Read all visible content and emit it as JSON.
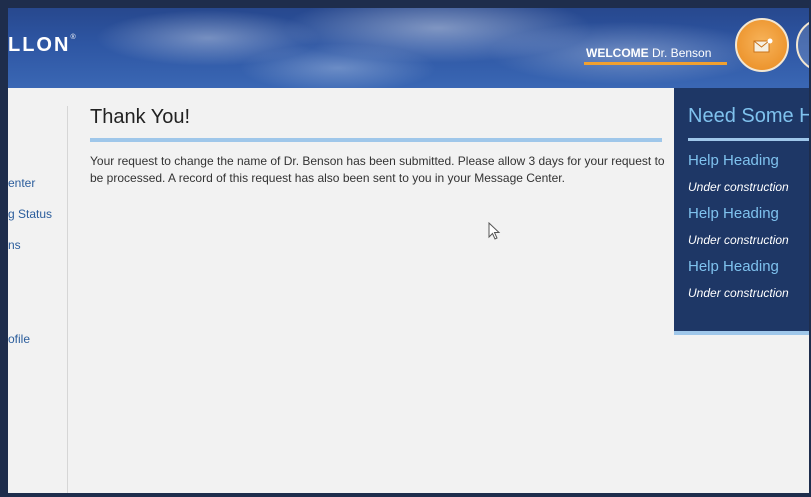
{
  "header": {
    "logo_text": "LLON",
    "logo_mark": "®",
    "welcome_label": "WELCOME",
    "user_name": "Dr. Benson",
    "mail_icon": "mail-icon"
  },
  "leftnav": {
    "items": [
      {
        "label": "enter"
      },
      {
        "label": "g Status"
      },
      {
        "label": "ns"
      },
      {
        "label": "ofile"
      }
    ]
  },
  "main": {
    "title": "Thank You!",
    "message": "Your request to change the name of Dr. Benson has been submitted. Please allow 3 days for your request to be processed. A record of this request has also been sent to you in your Message Center."
  },
  "help": {
    "title": "Need Some H",
    "items": [
      {
        "heading": "Help Heading",
        "sub": "Under construction"
      },
      {
        "heading": "Help Heading",
        "sub": "Under construction"
      },
      {
        "heading": "Help Heading",
        "sub": "Under construction"
      }
    ]
  },
  "colors": {
    "header_blue": "#2e56a3",
    "accent_orange": "#f0a030",
    "light_blue_rule": "#9fc7ea",
    "help_panel_bg": "#1e3766",
    "help_link": "#7fc2ee",
    "nav_link": "#2b5d9c"
  }
}
